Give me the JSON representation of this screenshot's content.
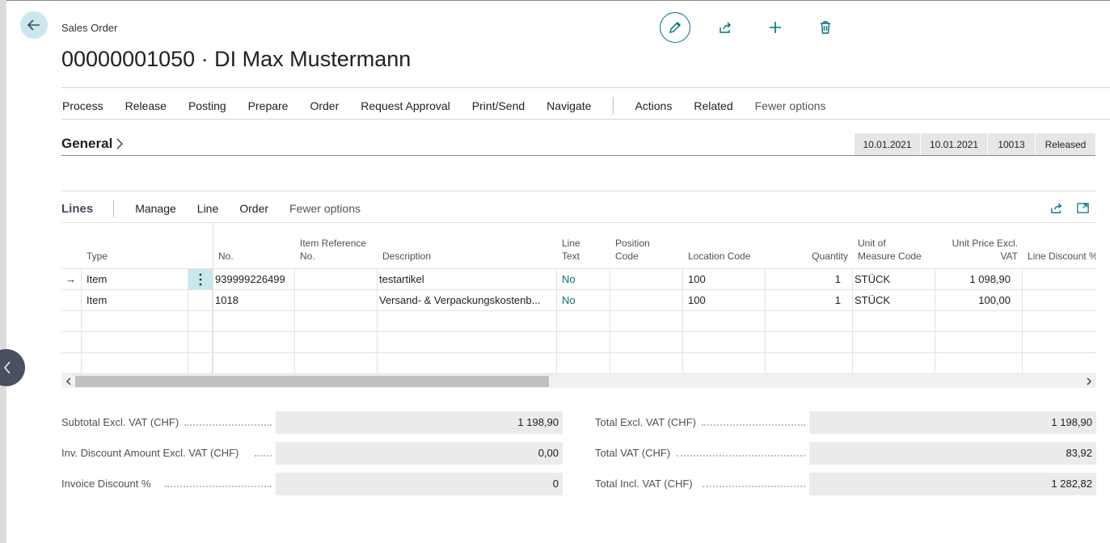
{
  "header": {
    "caption": "Sales Order",
    "title": "00000001050 · DI Max Mustermann"
  },
  "header_actions": [
    "pencil-icon",
    "share-icon",
    "plus-icon",
    "trash-icon"
  ],
  "menu": {
    "items": [
      "Process",
      "Release",
      "Posting",
      "Prepare",
      "Order",
      "Request Approval",
      "Print/Send",
      "Navigate"
    ],
    "secondary": [
      "Actions",
      "Related"
    ],
    "fewer": "Fewer options"
  },
  "general": {
    "label": "General",
    "facts": [
      "10.01.2021",
      "10.01.2021",
      "10013",
      "Released"
    ]
  },
  "lines": {
    "title": "Lines",
    "actions": [
      "Manage",
      "Line",
      "Order"
    ],
    "fewer": "Fewer options",
    "columns": {
      "type": "Type",
      "no": "No.",
      "item_ref_1": "Item Reference",
      "item_ref_2": "No.",
      "description": "Description",
      "line_text_1": "Line",
      "line_text_2": "Text",
      "position_1": "Position",
      "position_2": "Code",
      "location": "Location Code",
      "quantity": "Quantity",
      "uom_1": "Unit of",
      "uom_2": "Measure Code",
      "price_1": "Unit Price Excl.",
      "price_2": "VAT",
      "discount": "Line Discount %"
    },
    "rows": [
      {
        "marker": "→",
        "type": "Item",
        "no": "939999226499",
        "item_ref": "",
        "description": "testartikel",
        "line_text": "No",
        "position": "",
        "location": "100",
        "quantity": "1",
        "uom": "STÜCK",
        "price": "1 098,90",
        "discount": ""
      },
      {
        "marker": "",
        "type": "Item",
        "no": "1018",
        "item_ref": "",
        "description": "Versand- & Verpackungskostenb...",
        "line_text": "No",
        "position": "",
        "location": "100",
        "quantity": "1",
        "uom": "STÜCK",
        "price": "100,00",
        "discount": ""
      },
      {
        "marker": "",
        "type": "",
        "no": "",
        "item_ref": "",
        "description": "",
        "line_text": "",
        "position": "",
        "location": "",
        "quantity": "",
        "uom": "",
        "price": "",
        "discount": ""
      },
      {
        "marker": "",
        "type": "",
        "no": "",
        "item_ref": "",
        "description": "",
        "line_text": "",
        "position": "",
        "location": "",
        "quantity": "",
        "uom": "",
        "price": "",
        "discount": ""
      },
      {
        "marker": "",
        "type": "",
        "no": "",
        "item_ref": "",
        "description": "",
        "line_text": "",
        "position": "",
        "location": "",
        "quantity": "",
        "uom": "",
        "price": "",
        "discount": ""
      }
    ],
    "scroll_fraction": 0.47
  },
  "totals": {
    "left": [
      {
        "label": "Subtotal Excl. VAT (CHF)",
        "value": "1 198,90"
      },
      {
        "label": "Inv. Discount Amount Excl. VAT (CHF)",
        "value": "0,00"
      },
      {
        "label": "Invoice Discount %",
        "value": "0"
      }
    ],
    "right": [
      {
        "label": "Total Excl. VAT (CHF)",
        "value": "1 198,90"
      },
      {
        "label": "Total VAT (CHF)",
        "value": "83,92"
      },
      {
        "label": "Total Incl. VAT (CHF)",
        "value": "1 282,82"
      }
    ]
  },
  "colors": {
    "accent": "#00707a",
    "back_bg": "#c9e8ee",
    "side_toggle": "#4a5060",
    "fact_bg": "#e6e6e6",
    "field_bg": "#ebebeb"
  }
}
